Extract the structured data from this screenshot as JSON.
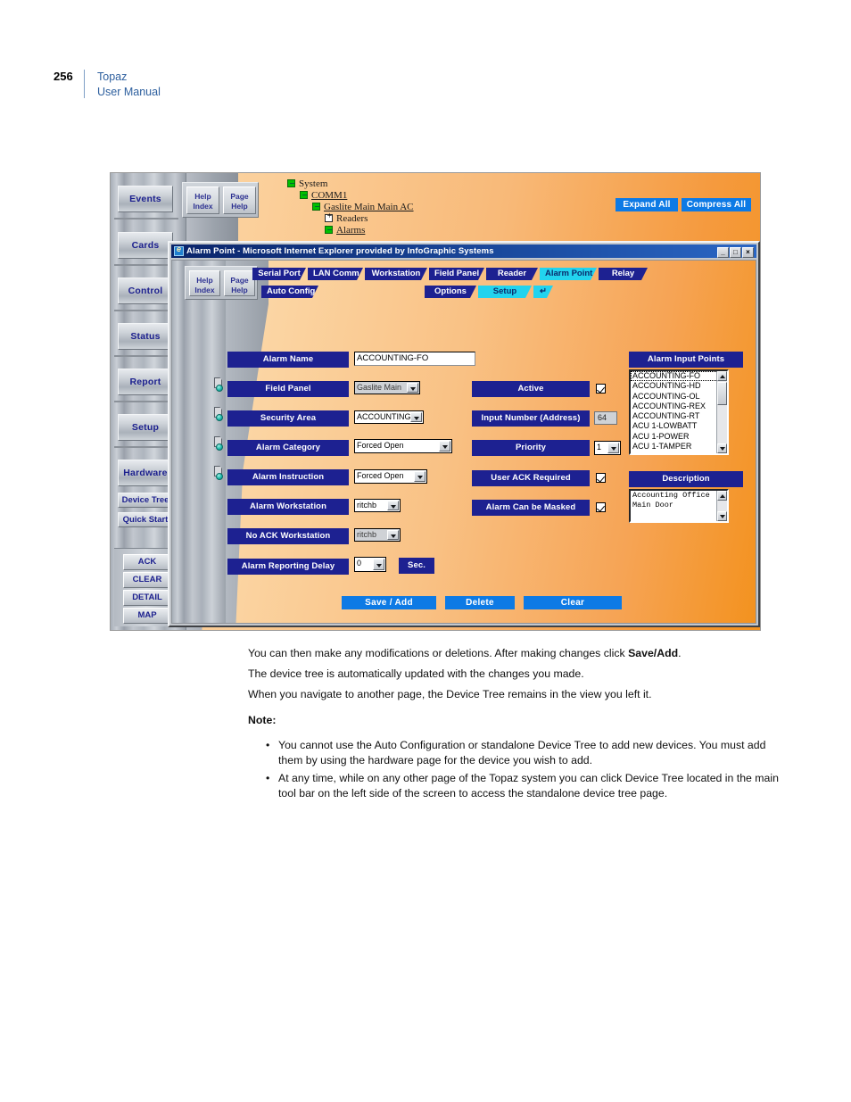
{
  "page": {
    "folio": "256",
    "title_line1": "Topaz",
    "title_line2": "User Manual"
  },
  "outer_app": {
    "help_index": {
      "line1": "Help",
      "line2": "Index"
    },
    "page_help": {
      "line1": "Page",
      "line2": "Help"
    },
    "nav_buttons": [
      "Events",
      "Cards",
      "Control",
      "Status",
      "Report",
      "Setup",
      "Hardware"
    ],
    "nav_small": [
      "Device Tree",
      "Quick Start"
    ],
    "ack_buttons": [
      "ACK",
      "CLEAR",
      "DETAIL",
      "MAP"
    ],
    "tree": [
      {
        "label": "System",
        "state": "filled",
        "link": false
      },
      {
        "label": "COMM1",
        "state": "filled",
        "link": true
      },
      {
        "label": "Gaslite Main Main AC",
        "state": "filled",
        "link": true
      },
      {
        "label": "Readers",
        "state": "plus",
        "link": false
      },
      {
        "label": "Alarms",
        "state": "filled",
        "link": true
      }
    ],
    "expand_all": "Expand All",
    "compress_all": "Compress All"
  },
  "ie_window": {
    "title": "Alarm Point - Microsoft Internet Explorer provided by InfoGraphic Systems",
    "icon": "ie-icon",
    "window_buttons": {
      "minimize": "_",
      "maximize": "□",
      "close": "×"
    },
    "help_index": {
      "line1": "Help",
      "line2": "Index"
    },
    "page_help": {
      "line1": "Page",
      "line2": "Help"
    },
    "tabs_row1": [
      {
        "label": "Serial Port",
        "active": false
      },
      {
        "label": "LAN Comm",
        "active": false
      },
      {
        "label": "Workstation",
        "active": false
      },
      {
        "label": "Field Panel",
        "active": false
      },
      {
        "label": "Reader",
        "active": false
      },
      {
        "label": "Alarm Point",
        "active": true
      },
      {
        "label": "Relay",
        "active": false
      }
    ],
    "tabs_row2": [
      {
        "label": "Auto Config",
        "active": false
      },
      {
        "label": "Options",
        "active": false
      },
      {
        "label": "Setup",
        "active": true
      },
      {
        "label": "↵",
        "active": true
      }
    ]
  },
  "form": {
    "left_fields": [
      {
        "label": "Alarm Name",
        "control": "text",
        "value": "ACCOUNTING-FO",
        "icon": false,
        "disabled": false
      },
      {
        "label": "Field Panel",
        "control": "select",
        "value": "Gaslite Main",
        "icon": true,
        "disabled": true
      },
      {
        "label": "Security Area",
        "control": "select",
        "value": "ACCOUNTING",
        "icon": true,
        "disabled": false
      },
      {
        "label": "Alarm Category",
        "control": "select",
        "value": "Forced Open",
        "icon": true,
        "disabled": false
      },
      {
        "label": "Alarm Instruction",
        "control": "select",
        "value": "Forced Open",
        "icon": true,
        "disabled": false
      },
      {
        "label": "Alarm Workstation",
        "control": "select",
        "value": "ritchb",
        "icon": false,
        "disabled": false
      },
      {
        "label": "No ACK Workstation",
        "control": "select",
        "value": "ritchb",
        "icon": false,
        "disabled": true
      },
      {
        "label": "Alarm Reporting Delay",
        "control": "select",
        "value": "0",
        "icon": false,
        "disabled": false
      }
    ],
    "sec_label": "Sec.",
    "right_fields": [
      {
        "label": "Active",
        "control": "checkbox",
        "value": "checked"
      },
      {
        "label": "Input Number (Address)",
        "control": "readonly",
        "value": "64"
      },
      {
        "label": "Priority",
        "control": "select",
        "value": "1"
      },
      {
        "label": "User ACK Required",
        "control": "checkbox",
        "value": "checked"
      },
      {
        "label": "Alarm Can be Masked",
        "control": "checkbox",
        "value": "checked"
      }
    ],
    "alarm_input_points": {
      "header": "Alarm Input Points",
      "items": [
        "ACCOUNTING-FO",
        "ACCOUNTING-HD",
        "ACCOUNTING-OL",
        "ACCOUNTING-REX",
        "ACCOUNTING-RT",
        "ACU 1-LOWBATT",
        "ACU 1-POWER",
        "ACU 1-TAMPER"
      ],
      "selected_index": 0
    },
    "description": {
      "header": "Description",
      "lines": [
        "Accounting Office",
        "Main Door"
      ]
    },
    "action_buttons": [
      "Save / Add",
      "Delete",
      "Clear"
    ]
  },
  "body": {
    "p1_pre": "You can then make any modifications or deletions. After making changes click ",
    "p1_bold": "Save/Add",
    "p1_post": ".",
    "p2": "The device tree is automatically updated with the changes you made.",
    "p3": "When you navigate to another page, the Device Tree remains in the view you left it.",
    "note_heading": "Note:",
    "bullets": [
      "You cannot use the Auto Configuration or standalone Device Tree to add new devices. You must add them by using the hardware page for the device you wish to add.",
      "At any time, while on any other page of the Topaz system you can click Device Tree located in the main tool bar on the left side of the screen to access the standalone device tree page."
    ]
  },
  "colors": {
    "accent_blue": "#1d2191",
    "button_blue": "#0d7ae5",
    "active_tab_cyan": "#22d3ee",
    "background_orange": "#f3921f",
    "header_link": "#2d5f9e"
  }
}
